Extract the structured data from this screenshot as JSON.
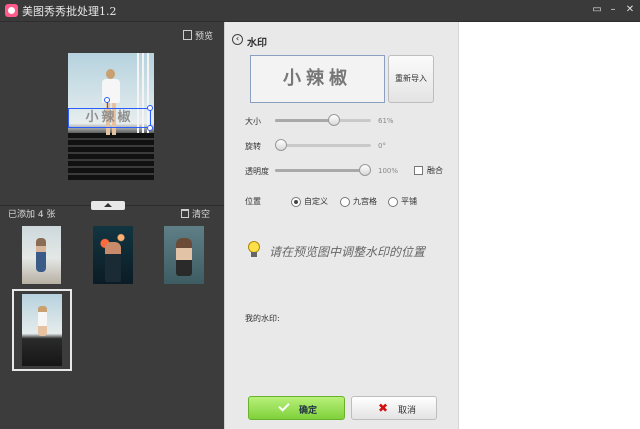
{
  "window": {
    "title": "美图秀秀批处理1.2"
  },
  "left": {
    "preview_label": "预览",
    "added_label": "已添加 4 张",
    "clear_label": "清空",
    "watermark_overlay_text": "小辣椒"
  },
  "panel": {
    "title": "水印",
    "watermark_text": "小辣椒",
    "reimport_label": "重新导入",
    "size_label": "大小",
    "size_value": "61%",
    "size_percent": 61,
    "rotate_label": "旋转",
    "rotate_value": "0°",
    "rotate_percent": 0,
    "opacity_label": "透明度",
    "opacity_value": "100%",
    "opacity_percent": 100,
    "blend_label": "融合",
    "position_label": "位置",
    "position_options": [
      "自定义",
      "九宫格",
      "平铺"
    ],
    "position_selected": "自定义",
    "hint_text": "请在预览图中调整水印的位置",
    "my_watermark_label": "我的水印:",
    "ok_label": "确定",
    "cancel_label": "取消"
  },
  "colors": {
    "ok_green": "#8ad640",
    "cancel_x": "#d01010",
    "selection_blue": "#2a5cff"
  },
  "icons": [
    "preview-icon",
    "trash-icon",
    "back-arrow-icon",
    "bulb-icon",
    "check-icon",
    "close-x-icon",
    "expand-arrow-icon"
  ]
}
